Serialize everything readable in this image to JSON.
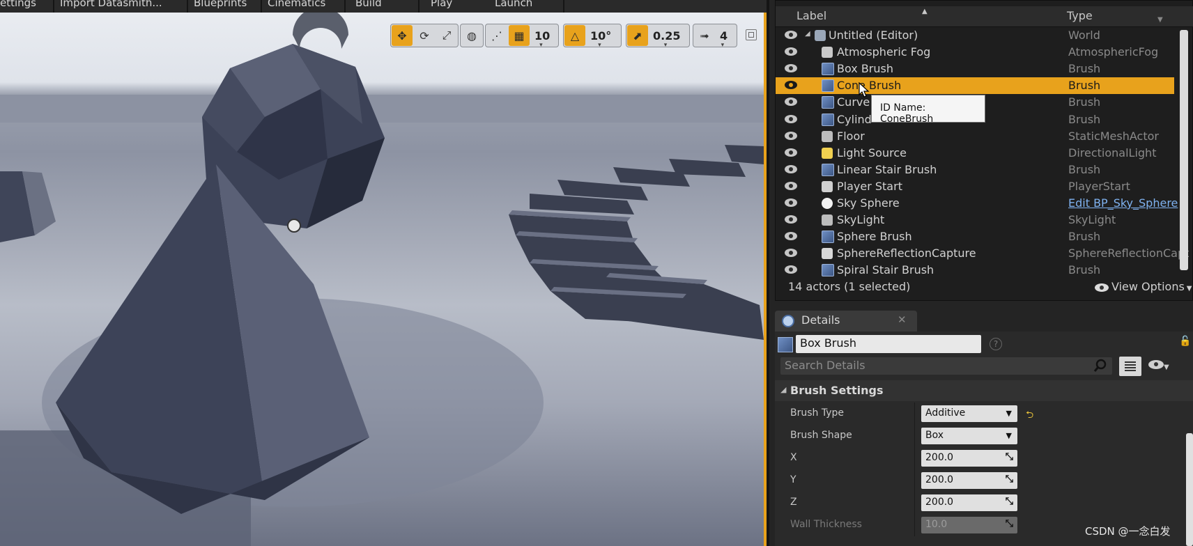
{
  "toolbar": {
    "items": [
      "ettings",
      "Import Datasmith...",
      "Blueprints",
      "Cinematics",
      "Build",
      "Play",
      "Launch"
    ]
  },
  "viewport": {
    "grid_snap": "10",
    "rotation_snap": "10°",
    "scale_snap": "0.25",
    "camera_speed": "4",
    "accent_color": "#e8a21c"
  },
  "outliner": {
    "header": {
      "label": "Label",
      "type": "Type"
    },
    "rows": [
      {
        "name": "Untitled (Editor)",
        "type": "World",
        "icon": "world-icon"
      },
      {
        "name": "Atmospheric Fog",
        "type": "AtmosphericFog",
        "icon": "fog-icon"
      },
      {
        "name": "Box Brush",
        "type": "Brush",
        "icon": "brush-icon"
      },
      {
        "name": "Cone Brush",
        "type": "Brush",
        "icon": "brush-icon"
      },
      {
        "name": "Curve",
        "type": "Brush",
        "icon": "brush-icon"
      },
      {
        "name": "Cylind",
        "type": "Brush",
        "icon": "brush-icon"
      },
      {
        "name": "Floor",
        "type": "StaticMeshActor",
        "icon": "static-mesh-icon"
      },
      {
        "name": "Light Source",
        "type": "DirectionalLight",
        "icon": "light-icon"
      },
      {
        "name": "Linear Stair Brush",
        "type": "Brush",
        "icon": "brush-icon"
      },
      {
        "name": "Player Start",
        "type": "PlayerStart",
        "icon": "player-start-icon"
      },
      {
        "name": "Sky Sphere",
        "type": "Edit BP_Sky_Sphere",
        "icon": "sphere-icon"
      },
      {
        "name": "SkyLight",
        "type": "SkyLight",
        "icon": "skylight-icon"
      },
      {
        "name": "Sphere Brush",
        "type": "Brush",
        "icon": "brush-icon"
      },
      {
        "name": "SphereReflectionCapture",
        "type": "SphereReflectionCapt",
        "icon": "reflection-capture-icon"
      },
      {
        "name": "Spiral Stair Brush",
        "type": "Brush",
        "icon": "brush-icon"
      }
    ],
    "tooltip": "ID Name: ConeBrush",
    "footer_count": "14 actors (1 selected)",
    "view_options": "View Options"
  },
  "details": {
    "tab_title": "Details",
    "object_name": "Box Brush",
    "search_placeholder": "Search Details",
    "section": "Brush Settings",
    "props": {
      "brush_type_label": "Brush Type",
      "brush_type_value": "Additive",
      "brush_shape_label": "Brush Shape",
      "brush_shape_value": "Box",
      "x_label": "X",
      "x_value": "200.0",
      "y_label": "Y",
      "y_value": "200.0",
      "z_label": "Z",
      "z_value": "200.0",
      "wall_label": "Wall Thickness",
      "wall_value": "10.0"
    }
  },
  "watermark": "CSDN @一念白发"
}
